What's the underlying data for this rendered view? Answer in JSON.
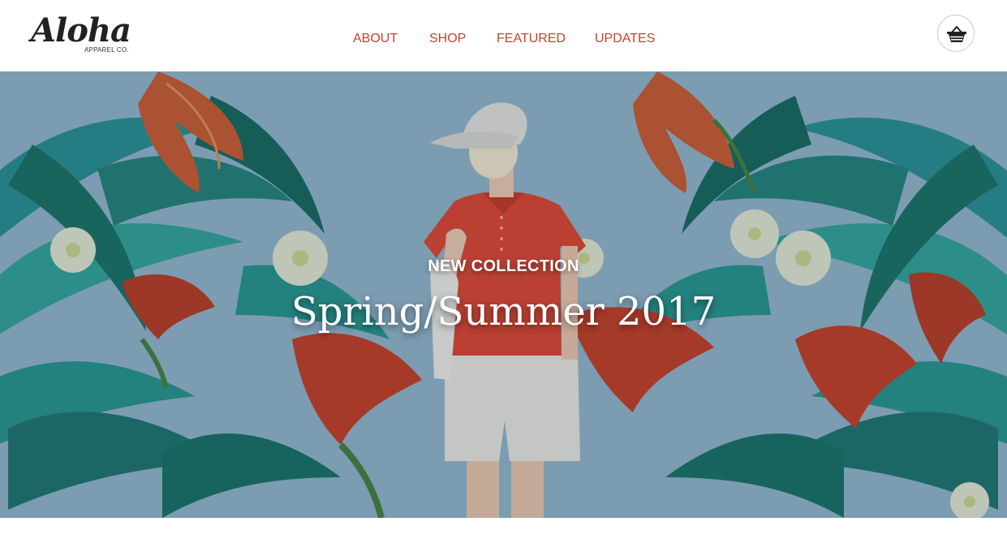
{
  "brand": {
    "logo_text": "Aloha",
    "logo_subtext": "APPAREL CO."
  },
  "nav": {
    "items": [
      {
        "label": "ABOUT"
      },
      {
        "label": "SHOP"
      },
      {
        "label": "FEATURED"
      },
      {
        "label": "UPDATES"
      }
    ]
  },
  "header": {
    "cart_icon": "basket-icon"
  },
  "hero": {
    "eyebrow": "NEW COLLECTION",
    "title": "Spring/Summer 2017",
    "background": "tropical-floral-model-photo"
  },
  "colors": {
    "nav_accent": "#c8412a",
    "hero_sky": "#8fb1c9",
    "hero_text": "#ffffff"
  }
}
